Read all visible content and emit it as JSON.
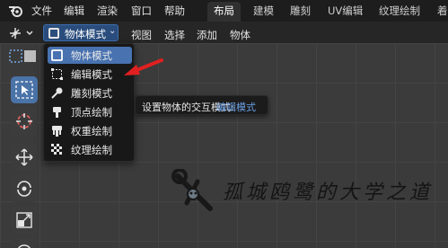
{
  "topbar": {
    "menu": [
      "文件",
      "编辑",
      "渲染",
      "窗口",
      "帮助"
    ],
    "workspaces": [
      "布局",
      "建模",
      "雕刻",
      "UV编辑",
      "纹理绘制",
      "着"
    ],
    "active_workspace": "布局"
  },
  "header": {
    "mode_label": "物体模式",
    "menus": [
      "视图",
      "选择",
      "添加",
      "物体"
    ]
  },
  "dropdown": {
    "items": [
      {
        "label": "物体模式",
        "icon": "cube-icon",
        "selected": true
      },
      {
        "label": "编辑模式",
        "icon": "edit-mesh-icon",
        "selected": false
      },
      {
        "label": "雕刻模式",
        "icon": "sculpt-brush-icon",
        "selected": false
      },
      {
        "label": "顶点绘制",
        "icon": "vertex-paint-icon",
        "selected": false
      },
      {
        "label": "权重绘制",
        "icon": "weight-paint-icon",
        "selected": false
      },
      {
        "label": "纹理绘制",
        "icon": "texture-paint-icon",
        "selected": false
      }
    ]
  },
  "tooltip": {
    "prefix": "设置物体的交互模式: ",
    "highlight": "编辑模式"
  },
  "watermark": {
    "text": "孤城鸥鹭的大学之道"
  },
  "colors": {
    "accent": "#4872b0",
    "arrow": "#e02020",
    "tooltip_highlight": "#6a9fe4"
  }
}
